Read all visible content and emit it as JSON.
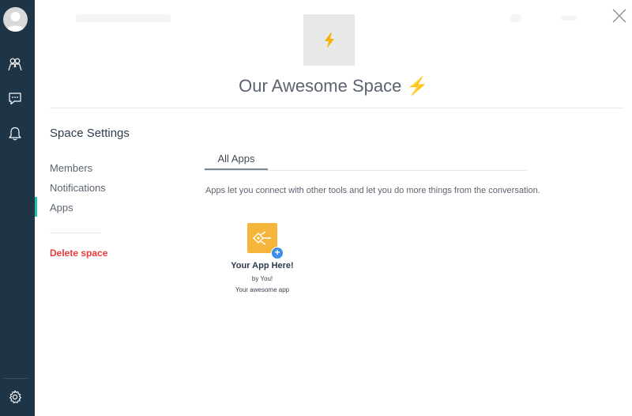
{
  "sidebar": {
    "icons": [
      "user-avatar",
      "people-icon",
      "chat-icon",
      "bell-icon",
      "gear-icon"
    ]
  },
  "header": {
    "space_icon": "lightning-bolt",
    "space_name": "Our Awesome Space",
    "space_emoji": "⚡"
  },
  "settings": {
    "title": "Space Settings",
    "menu": [
      {
        "label": "Members"
      },
      {
        "label": "Notifications"
      },
      {
        "label": "Apps"
      }
    ],
    "active_index": 2,
    "delete_label": "Delete space"
  },
  "apps": {
    "tabs": [
      {
        "label": "All Apps"
      }
    ],
    "description": "Apps let you connect with other tools and let you do more things from the conversation.",
    "items": [
      {
        "name": "Your App Here!",
        "by": "by You!",
        "description": "Your awesome app"
      }
    ]
  },
  "colors": {
    "sidebar_bg": "#1e3447",
    "accent": "#1ec2a9",
    "danger": "#ea3a3a",
    "bolt": "#f5b400",
    "app_tile": "#f5b43a",
    "plus_badge": "#3d8ee6"
  }
}
